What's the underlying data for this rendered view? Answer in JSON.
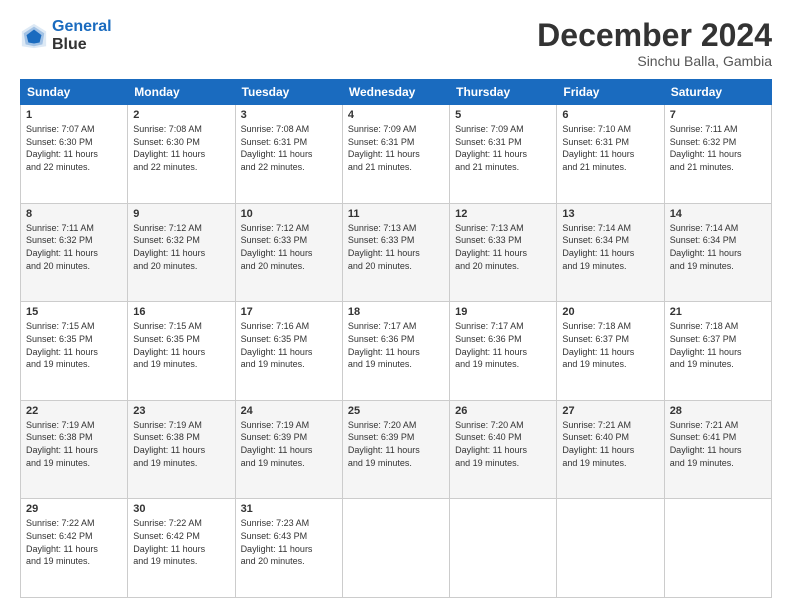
{
  "logo": {
    "line1": "General",
    "line2": "Blue"
  },
  "title": "December 2024",
  "location": "Sinchu Balla, Gambia",
  "headers": [
    "Sunday",
    "Monday",
    "Tuesday",
    "Wednesday",
    "Thursday",
    "Friday",
    "Saturday"
  ],
  "weeks": [
    [
      {
        "day": "1",
        "info": "Sunrise: 7:07 AM\nSunset: 6:30 PM\nDaylight: 11 hours\nand 22 minutes."
      },
      {
        "day": "2",
        "info": "Sunrise: 7:08 AM\nSunset: 6:30 PM\nDaylight: 11 hours\nand 22 minutes."
      },
      {
        "day": "3",
        "info": "Sunrise: 7:08 AM\nSunset: 6:31 PM\nDaylight: 11 hours\nand 22 minutes."
      },
      {
        "day": "4",
        "info": "Sunrise: 7:09 AM\nSunset: 6:31 PM\nDaylight: 11 hours\nand 21 minutes."
      },
      {
        "day": "5",
        "info": "Sunrise: 7:09 AM\nSunset: 6:31 PM\nDaylight: 11 hours\nand 21 minutes."
      },
      {
        "day": "6",
        "info": "Sunrise: 7:10 AM\nSunset: 6:31 PM\nDaylight: 11 hours\nand 21 minutes."
      },
      {
        "day": "7",
        "info": "Sunrise: 7:11 AM\nSunset: 6:32 PM\nDaylight: 11 hours\nand 21 minutes."
      }
    ],
    [
      {
        "day": "8",
        "info": "Sunrise: 7:11 AM\nSunset: 6:32 PM\nDaylight: 11 hours\nand 20 minutes."
      },
      {
        "day": "9",
        "info": "Sunrise: 7:12 AM\nSunset: 6:32 PM\nDaylight: 11 hours\nand 20 minutes."
      },
      {
        "day": "10",
        "info": "Sunrise: 7:12 AM\nSunset: 6:33 PM\nDaylight: 11 hours\nand 20 minutes."
      },
      {
        "day": "11",
        "info": "Sunrise: 7:13 AM\nSunset: 6:33 PM\nDaylight: 11 hours\nand 20 minutes."
      },
      {
        "day": "12",
        "info": "Sunrise: 7:13 AM\nSunset: 6:33 PM\nDaylight: 11 hours\nand 20 minutes."
      },
      {
        "day": "13",
        "info": "Sunrise: 7:14 AM\nSunset: 6:34 PM\nDaylight: 11 hours\nand 19 minutes."
      },
      {
        "day": "14",
        "info": "Sunrise: 7:14 AM\nSunset: 6:34 PM\nDaylight: 11 hours\nand 19 minutes."
      }
    ],
    [
      {
        "day": "15",
        "info": "Sunrise: 7:15 AM\nSunset: 6:35 PM\nDaylight: 11 hours\nand 19 minutes."
      },
      {
        "day": "16",
        "info": "Sunrise: 7:15 AM\nSunset: 6:35 PM\nDaylight: 11 hours\nand 19 minutes."
      },
      {
        "day": "17",
        "info": "Sunrise: 7:16 AM\nSunset: 6:35 PM\nDaylight: 11 hours\nand 19 minutes."
      },
      {
        "day": "18",
        "info": "Sunrise: 7:17 AM\nSunset: 6:36 PM\nDaylight: 11 hours\nand 19 minutes."
      },
      {
        "day": "19",
        "info": "Sunrise: 7:17 AM\nSunset: 6:36 PM\nDaylight: 11 hours\nand 19 minutes."
      },
      {
        "day": "20",
        "info": "Sunrise: 7:18 AM\nSunset: 6:37 PM\nDaylight: 11 hours\nand 19 minutes."
      },
      {
        "day": "21",
        "info": "Sunrise: 7:18 AM\nSunset: 6:37 PM\nDaylight: 11 hours\nand 19 minutes."
      }
    ],
    [
      {
        "day": "22",
        "info": "Sunrise: 7:19 AM\nSunset: 6:38 PM\nDaylight: 11 hours\nand 19 minutes."
      },
      {
        "day": "23",
        "info": "Sunrise: 7:19 AM\nSunset: 6:38 PM\nDaylight: 11 hours\nand 19 minutes."
      },
      {
        "day": "24",
        "info": "Sunrise: 7:19 AM\nSunset: 6:39 PM\nDaylight: 11 hours\nand 19 minutes."
      },
      {
        "day": "25",
        "info": "Sunrise: 7:20 AM\nSunset: 6:39 PM\nDaylight: 11 hours\nand 19 minutes."
      },
      {
        "day": "26",
        "info": "Sunrise: 7:20 AM\nSunset: 6:40 PM\nDaylight: 11 hours\nand 19 minutes."
      },
      {
        "day": "27",
        "info": "Sunrise: 7:21 AM\nSunset: 6:40 PM\nDaylight: 11 hours\nand 19 minutes."
      },
      {
        "day": "28",
        "info": "Sunrise: 7:21 AM\nSunset: 6:41 PM\nDaylight: 11 hours\nand 19 minutes."
      }
    ],
    [
      {
        "day": "29",
        "info": "Sunrise: 7:22 AM\nSunset: 6:42 PM\nDaylight: 11 hours\nand 19 minutes."
      },
      {
        "day": "30",
        "info": "Sunrise: 7:22 AM\nSunset: 6:42 PM\nDaylight: 11 hours\nand 19 minutes."
      },
      {
        "day": "31",
        "info": "Sunrise: 7:23 AM\nSunset: 6:43 PM\nDaylight: 11 hours\nand 20 minutes."
      },
      {
        "day": "",
        "info": ""
      },
      {
        "day": "",
        "info": ""
      },
      {
        "day": "",
        "info": ""
      },
      {
        "day": "",
        "info": ""
      }
    ]
  ]
}
